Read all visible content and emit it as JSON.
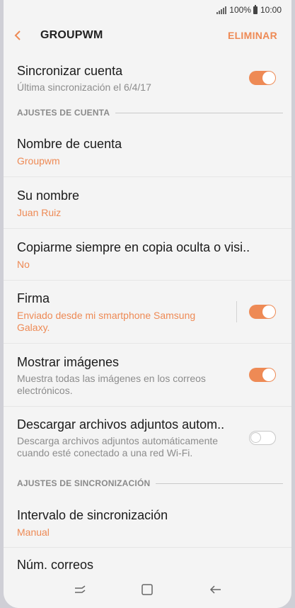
{
  "status": {
    "battery": "100%",
    "time": "10:00"
  },
  "appbar": {
    "title": "GROUPWM",
    "delete_label": "ELIMINAR"
  },
  "sync_account": {
    "title": "Sincronizar cuenta",
    "subtitle": "Última sincronización el 6/4/17",
    "enabled": true
  },
  "account_settings": {
    "header": "AJUSTES DE CUENTA",
    "account_name": {
      "title": "Nombre de cuenta",
      "value": "Groupwm"
    },
    "your_name": {
      "title": "Su nombre",
      "value": "Juan Ruiz"
    },
    "bcc": {
      "title": "Copiarme siempre en copia oculta o visi..",
      "value": "No"
    },
    "signature": {
      "title": "Firma",
      "value": "Enviado desde mi smartphone Samsung Galaxy.",
      "enabled": true
    },
    "show_images": {
      "title": "Mostrar imágenes",
      "subtitle": "Muestra todas las imágenes en los correos electrónicos.",
      "enabled": true
    },
    "auto_download": {
      "title": "Descargar archivos adjuntos autom..",
      "subtitle": "Descarga archivos adjuntos automáticamente cuando esté conectado a una red Wi-Fi.",
      "enabled": false
    }
  },
  "sync_settings": {
    "header": "AJUSTES DE SINCRONIZACIÓN",
    "interval": {
      "title": "Intervalo de sincronización",
      "value": "Manual"
    },
    "next_partial": "Núm. correos"
  },
  "colors": {
    "accent": "#ee8a55",
    "background": "#f4f4f4"
  },
  "icons": {
    "back": "back-arrow-icon",
    "recents": "recents-icon",
    "home": "home-icon",
    "nav_back": "nav-back-icon"
  }
}
